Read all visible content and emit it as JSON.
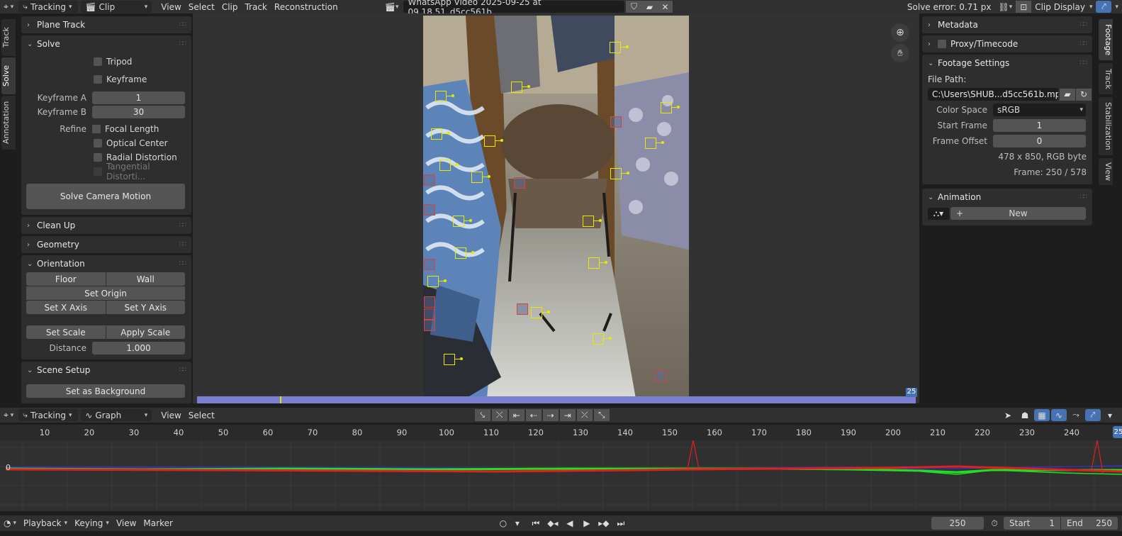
{
  "topbar": {
    "mode": "Tracking",
    "view_type": "Clip",
    "menus": [
      "View",
      "Select",
      "Clip",
      "Track",
      "Reconstruction"
    ],
    "clip_name": "WhatsApp Video 2025-09-25 at 09.18.51_d5cc561b....",
    "solve_error": "Solve error: 0.71 px",
    "clip_display": "Clip Display"
  },
  "left_tabs": [
    "Track",
    "Solve",
    "Annotation"
  ],
  "left_panels": {
    "plane_track": "Plane Track",
    "solve": {
      "title": "Solve",
      "tripod": "Tripod",
      "keyframe": "Keyframe",
      "keyframe_a_label": "Keyframe A",
      "keyframe_a": "1",
      "keyframe_b_label": "Keyframe B",
      "keyframe_b": "30",
      "refine_label": "Refine",
      "focal_length": "Focal Length",
      "optical_center": "Optical Center",
      "radial_distortion": "Radial Distortion",
      "tangential": "Tangential Distorti...",
      "solve_button": "Solve Camera Motion"
    },
    "clean_up": "Clean Up",
    "geometry": "Geometry",
    "orientation": {
      "title": "Orientation",
      "floor": "Floor",
      "wall": "Wall",
      "set_origin": "Set Origin",
      "set_x_axis": "Set X Axis",
      "set_y_axis": "Set Y Axis",
      "set_scale": "Set Scale",
      "apply_scale": "Apply Scale",
      "distance_label": "Distance",
      "distance": "1.000"
    },
    "scene_setup": {
      "title": "Scene Setup",
      "set_background": "Set as Background"
    }
  },
  "right_panels": {
    "metadata": "Metadata",
    "proxy": "Proxy/Timecode",
    "footage_settings": {
      "title": "Footage Settings",
      "file_path_label": "File Path:",
      "file_path": "C:\\Users\\SHUB...d5cc561b.mp4",
      "color_space_label": "Color Space",
      "color_space": "sRGB",
      "start_frame_label": "Start Frame",
      "start_frame": "1",
      "frame_offset_label": "Frame Offset",
      "frame_offset": "0",
      "resolution": "478 x 850, RGB byte",
      "frame_info": "Frame: 250 / 578"
    },
    "animation": {
      "title": "Animation",
      "new_button": "New"
    }
  },
  "right_tabs": [
    "Footage",
    "Track",
    "Stabilization",
    "View"
  ],
  "timeline_frame_badge": "25",
  "graph_header": {
    "mode": "Tracking",
    "view_type": "Graph",
    "menus": [
      "View",
      "Select"
    ]
  },
  "graph": {
    "ticks": [
      "10",
      "20",
      "30",
      "40",
      "50",
      "60",
      "70",
      "80",
      "90",
      "100",
      "110",
      "120",
      "130",
      "140",
      "150",
      "160",
      "170",
      "180",
      "190",
      "200",
      "210",
      "220",
      "230",
      "240"
    ],
    "zero_label": "0",
    "current_badge": "25"
  },
  "footer": {
    "playback": "Playback",
    "keying": "Keying",
    "view": "View",
    "marker": "Marker",
    "current_frame": "250",
    "start_label": "Start",
    "start": "1",
    "end_label": "End",
    "end": "250"
  },
  "colors": {
    "accent": "#4772b3",
    "marker": "#e8e800",
    "disabled_marker": "#d24545",
    "curve_red": "#e02020",
    "curve_green": "#20e020",
    "curve_blue": "#3030e0"
  }
}
